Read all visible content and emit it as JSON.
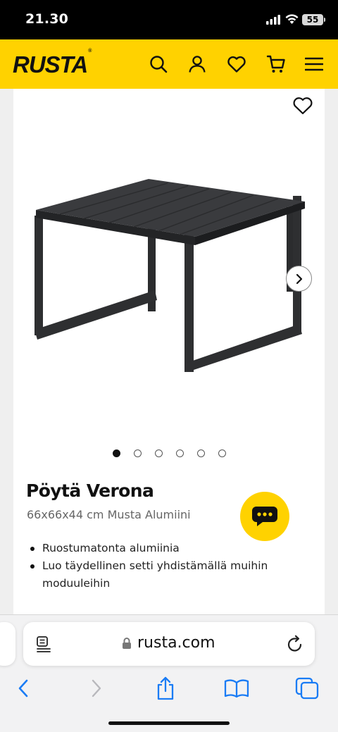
{
  "status_bar": {
    "time": "21.30",
    "battery": "55"
  },
  "header": {
    "logo": "RUSTA",
    "logo_mark": "®",
    "icons": [
      "search-icon",
      "account-icon",
      "wishlist-icon",
      "cart-icon",
      "menu-icon"
    ],
    "brand_color": "#ffd200"
  },
  "product": {
    "image_pagination": {
      "total": 6,
      "active": 1
    },
    "title": "Pöytä Verona",
    "subtitle": "66x66x44 cm Musta Alumiini",
    "bullets": [
      "Ruostumatonta alumiinia",
      "Luo täydellinen setti yhdistämällä muihin moduuleihin"
    ]
  },
  "browser": {
    "url": "rusta.com",
    "toolbar_icons": [
      "back-icon",
      "forward-icon",
      "share-icon",
      "bookmarks-icon",
      "tabs-icon"
    ]
  }
}
